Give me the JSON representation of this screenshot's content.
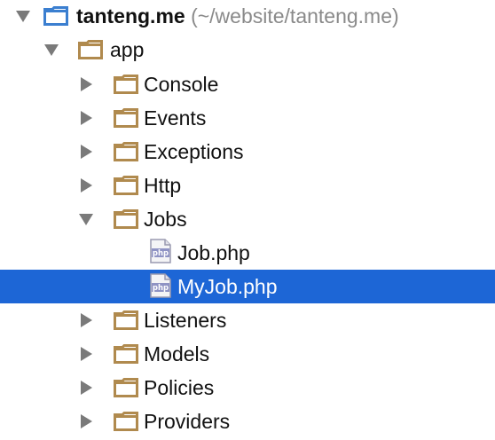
{
  "root": {
    "name": "tanteng.me",
    "path": "(~/website/tanteng.me)"
  },
  "app": {
    "label": "app"
  },
  "folders": [
    {
      "label": "Console"
    },
    {
      "label": "Events"
    },
    {
      "label": "Exceptions"
    },
    {
      "label": "Http"
    },
    {
      "label": "Jobs"
    },
    {
      "label": "Listeners"
    },
    {
      "label": "Models"
    },
    {
      "label": "Policies"
    },
    {
      "label": "Providers"
    }
  ],
  "jobs_files": [
    {
      "label": "Job.php",
      "icon": "php-file-icon",
      "selected": false
    },
    {
      "label": "MyJob.php",
      "icon": "php-file-icon",
      "selected": true
    }
  ],
  "colors": {
    "selection": "#1d66d6",
    "folder_outline": "#b08a4e",
    "module_outline": "#3b7fd0",
    "arrow": "#7a7a7a"
  }
}
